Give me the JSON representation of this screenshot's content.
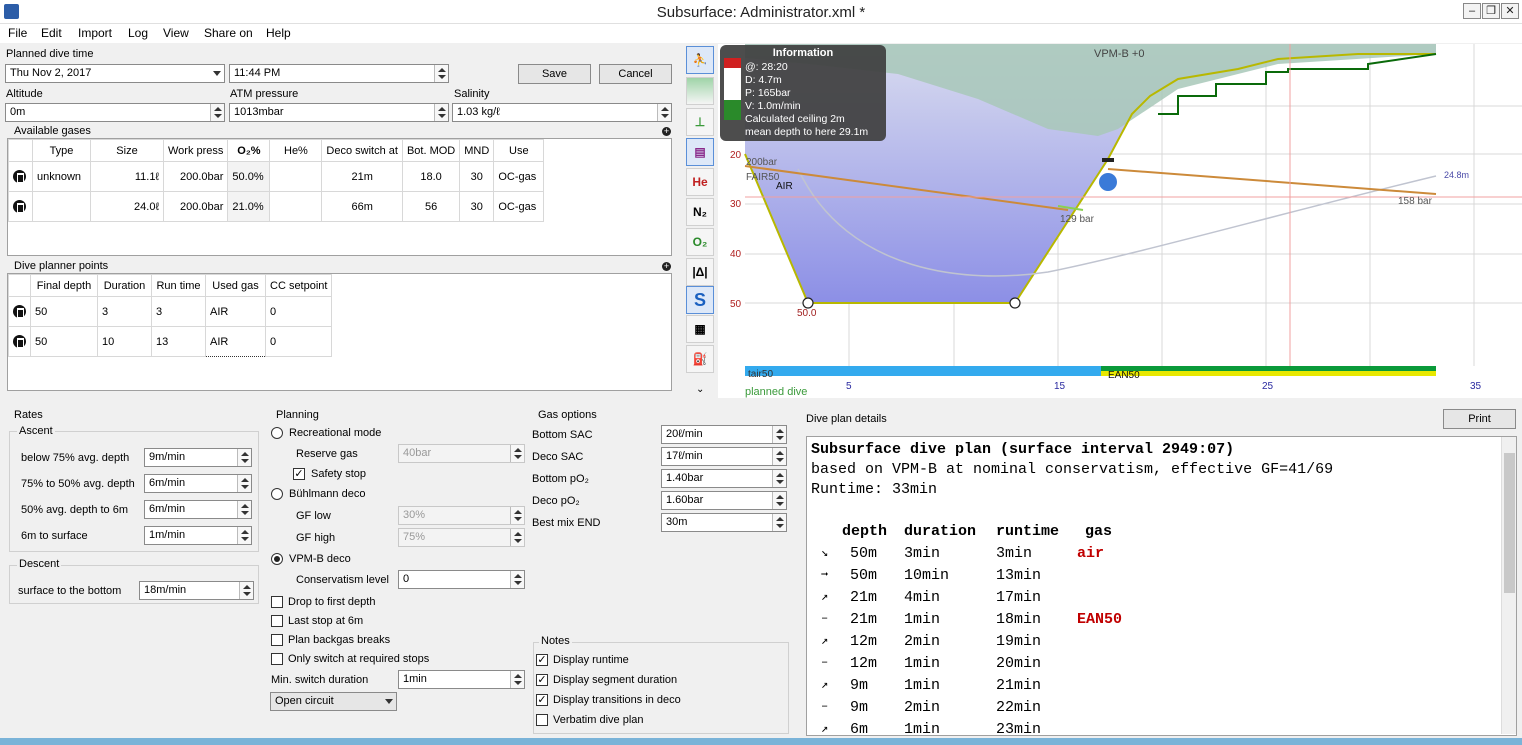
{
  "window": {
    "title": "Subsurface: Administrator.xml *"
  },
  "menu": [
    "File",
    "Edit",
    "Import",
    "Log",
    "View",
    "Share on",
    "Help"
  ],
  "planned": {
    "label": "Planned dive time",
    "date": "Thu Nov 2, 2017",
    "time": "11:44 PM",
    "save": "Save",
    "cancel": "Cancel"
  },
  "env": {
    "altitude_label": "Altitude",
    "altitude": "0m",
    "atm_label": "ATM pressure",
    "atm": "1013mbar",
    "salinity_label": "Salinity",
    "salinity": "1.03 kg/ℓ"
  },
  "gases": {
    "title": "Available gases",
    "headers": [
      "Type",
      "Size",
      "Work press",
      "O₂%",
      "He%",
      "Deco switch at",
      "Bot. MOD",
      "MND",
      "Use"
    ],
    "rows": [
      [
        "unknown",
        "11.1ℓ",
        "200.0bar",
        "50.0%",
        "",
        "21m",
        "18.0",
        "30",
        "OC-gas"
      ],
      [
        "",
        "24.0ℓ",
        "200.0bar",
        "21.0%",
        "",
        "66m",
        "56",
        "30",
        "OC-gas"
      ]
    ]
  },
  "points": {
    "title": "Dive planner points",
    "headers": [
      "Final depth",
      "Duration",
      "Run time",
      "Used gas",
      "CC setpoint"
    ],
    "rows": [
      [
        "50",
        "3",
        "3",
        "AIR",
        "0"
      ],
      [
        "50",
        "10",
        "13",
        "AIR",
        "0"
      ]
    ]
  },
  "rates": {
    "title": "Rates",
    "ascent": "Ascent",
    "items": [
      [
        "below 75% avg. depth",
        "9m/min"
      ],
      [
        "75% to 50% avg. depth",
        "6m/min"
      ],
      [
        "50% avg. depth to 6m",
        "6m/min"
      ],
      [
        "6m to surface",
        "1m/min"
      ]
    ],
    "descent": "Descent",
    "descent_label": "surface to the bottom",
    "descent_val": "18m/min"
  },
  "planning": {
    "title": "Planning",
    "recreational": "Recreational mode",
    "reserve_label": "Reserve gas",
    "reserve": "40bar",
    "safety": "Safety stop",
    "buhlmann": "Bühlmann deco",
    "gflow_label": "GF low",
    "gflow": "30%",
    "gfhigh_label": "GF high",
    "gfhigh": "75%",
    "vpmb": "VPM-B deco",
    "cons_label": "Conservatism level",
    "cons": "0",
    "drop": "Drop to first depth",
    "last": "Last stop at 6m",
    "backgas": "Plan backgas breaks",
    "only": "Only switch at required stops",
    "minsw_label": "Min. switch duration",
    "minsw": "1min",
    "circuit": "Open circuit"
  },
  "gasopts": {
    "title": "Gas options",
    "items": [
      [
        "Bottom SAC",
        "20ℓ/min"
      ],
      [
        "Deco SAC",
        "17ℓ/min"
      ],
      [
        "Bottom pO₂",
        "1.40bar"
      ],
      [
        "Deco pO₂",
        "1.60bar"
      ],
      [
        "Best mix END",
        "30m"
      ]
    ]
  },
  "notes": {
    "title": "Notes",
    "items": [
      [
        "Display runtime",
        true
      ],
      [
        "Display segment duration",
        true
      ],
      [
        "Display transitions in deco",
        true
      ],
      [
        "Verbatim dive plan",
        false
      ]
    ]
  },
  "details": {
    "title": "Dive plan details",
    "print": "Print",
    "line1": "Subsurface dive plan (surface interval 2949:07)",
    "line2": "based on VPM-B at nominal conservatism, effective GF=41/69",
    "line3": "Runtime: 33min",
    "head": [
      "depth",
      "duration",
      "runtime",
      "gas"
    ],
    "rows": [
      [
        "↘",
        "50m",
        "3min",
        "3min",
        "air"
      ],
      [
        "➞",
        "50m",
        "10min",
        "13min",
        ""
      ],
      [
        "↗",
        "21m",
        "4min",
        "17min",
        ""
      ],
      [
        "–",
        "21m",
        "1min",
        "18min",
        "EAN50"
      ],
      [
        "↗",
        "12m",
        "2min",
        "19min",
        ""
      ],
      [
        "–",
        "12m",
        "1min",
        "20min",
        ""
      ],
      [
        "↗",
        "9m",
        "1min",
        "21min",
        ""
      ],
      [
        "–",
        "9m",
        "2min",
        "22min",
        ""
      ],
      [
        "↗",
        "6m",
        "1min",
        "23min",
        ""
      ]
    ]
  },
  "profile": {
    "info": {
      "title": "Information",
      "lines": [
        "@: 28:20",
        "D: 4.7m",
        "P: 165bar",
        "V: 1.0m/min",
        "Calculated ceiling 2m",
        "mean depth to here 29.1m"
      ]
    },
    "labels": {
      "vpm": "VPM-B +0",
      "p1": "200bar",
      "fair": "FAIR50",
      "air": "AIR",
      "p129": "129 bar",
      "p158": "158 bar",
      "d248": "24.8m",
      "d50": "50.0",
      "ean": "EAN50",
      "tair": "tair50",
      "planned": "planned dive"
    },
    "yticks": [
      "20",
      "30",
      "40",
      "50"
    ],
    "xticks": [
      "5",
      "15",
      "25",
      "35"
    ],
    "colors": {
      "air_bar": "#33aaee",
      "ean_bar": "#00aa44",
      "accent": "#e8e800"
    }
  }
}
